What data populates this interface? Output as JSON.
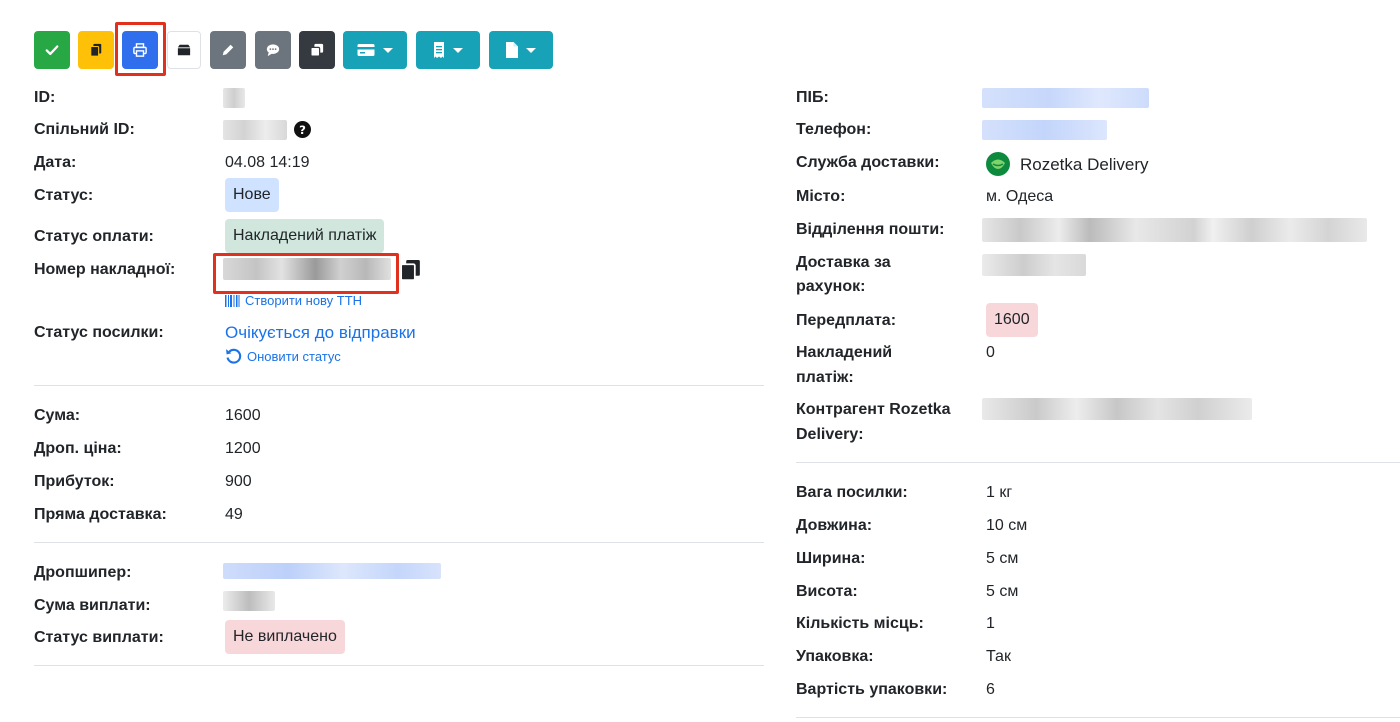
{
  "toolbar": {
    "buttons": [
      {
        "name": "confirm",
        "icon": "check-icon",
        "color": "#28a745"
      },
      {
        "name": "copy",
        "icon": "copy-icon",
        "color": "#ffc107"
      },
      {
        "name": "print",
        "icon": "print-icon",
        "color": "#2f6fed"
      },
      {
        "name": "box",
        "icon": "box-icon",
        "color": "#ffffff"
      },
      {
        "name": "edit",
        "icon": "pencil-icon",
        "color": "#6c757d"
      },
      {
        "name": "comment",
        "icon": "comment-icon",
        "color": "#6c757d"
      },
      {
        "name": "duplicate",
        "icon": "clone-icon",
        "color": "#343a40"
      },
      {
        "name": "payment-dropdown",
        "icon": "card-icon",
        "color": "#17a2b8"
      },
      {
        "name": "receipt-dropdown",
        "icon": "receipt-icon",
        "color": "#17a2b8"
      },
      {
        "name": "document-dropdown",
        "icon": "file-icon",
        "color": "#17a2b8"
      }
    ]
  },
  "left": {
    "id_label": "ID:",
    "shared_id_label": "Спільний ID:",
    "date_label": "Дата:",
    "date_value": "04.08 14:19",
    "status_label": "Статус:",
    "status_value": "Нове",
    "payment_status_label": "Статус оплати:",
    "payment_status_value": "Накладений платіж",
    "waybill_label": "Номер накладної:",
    "create_ttn_link": "Створити нову ТТН",
    "parcel_status_label": "Статус посилки:",
    "parcel_status_value": "Очікується до відправки",
    "refresh_status_link": "Оновити статус",
    "sum_label": "Сума:",
    "sum_value": "1600",
    "drop_price_label": "Дроп. ціна:",
    "drop_price_value": "1200",
    "profit_label": "Прибуток:",
    "profit_value": "900",
    "direct_delivery_label": "Пряма доставка:",
    "direct_delivery_value": "49",
    "dropshipper_label": "Дропшипер:",
    "payout_sum_label": "Сума виплати:",
    "payout_status_label": "Статус виплати:",
    "payout_status_value": "Не виплачено"
  },
  "right": {
    "name_label": "ПІБ:",
    "phone_label": "Телефон:",
    "delivery_service_label": "Служба доставки:",
    "delivery_service_value": "Rozetka Delivery",
    "city_label": "Місто:",
    "city_value": "м. Одеса",
    "post_office_label": "Відділення пошти:",
    "delivery_account_label_1": "Доставка за",
    "delivery_account_label_2": "рахунок:",
    "prepayment_label": "Передплата:",
    "prepayment_value": "1600",
    "cod_label_1": "Накладений",
    "cod_label_2": "платіж:",
    "cod_value": "0",
    "contractor_label_1": "Контрагент Rozetka",
    "contractor_label_2": "Delivery:",
    "weight_label": "Вага посилки:",
    "weight_value": "1 кг",
    "length_label": "Довжина:",
    "length_value": "10 см",
    "width_label": "Ширина:",
    "width_value": "5 см",
    "height_label": "Висота:",
    "height_value": "5 см",
    "places_label": "Кількість місць:",
    "places_value": "1",
    "packing_label": "Упаковка:",
    "packing_value": "Так",
    "packing_cost_label": "Вартість упаковки:",
    "packing_cost_value": "6"
  },
  "colors": {
    "badge_blue": "#cfe2ff",
    "badge_green": "#d1e7dd",
    "badge_red": "#f8d7da",
    "link": "#1a73e8",
    "highlight": "#e0301e"
  }
}
